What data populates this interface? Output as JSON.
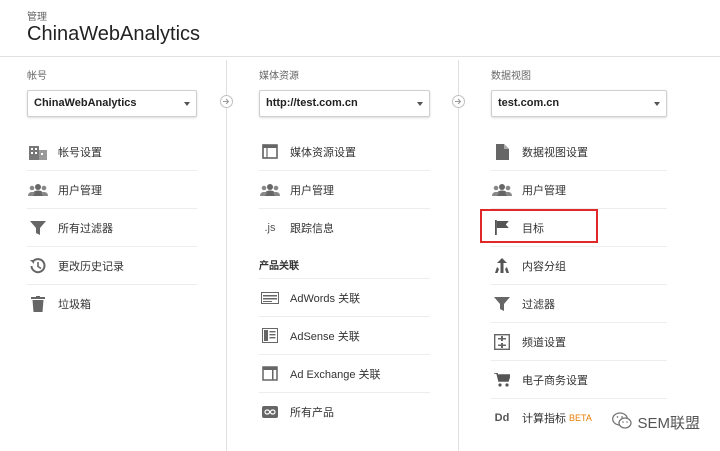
{
  "header": {
    "breadcrumb": "管理",
    "title": "ChinaWebAnalytics"
  },
  "account": {
    "label": "帐号",
    "selected": "ChinaWebAnalytics",
    "items": [
      {
        "label": "帐号设置",
        "icon": "account-settings-icon"
      },
      {
        "label": "用户管理",
        "icon": "users-icon"
      },
      {
        "label": "所有过滤器",
        "icon": "filter-icon"
      },
      {
        "label": "更改历史记录",
        "icon": "history-icon"
      },
      {
        "label": "垃圾箱",
        "icon": "trash-icon"
      }
    ]
  },
  "property": {
    "label": "媒体资源",
    "selected": "http://test.com.cn",
    "items": [
      {
        "label": "媒体资源设置",
        "icon": "property-settings-icon"
      },
      {
        "label": "用户管理",
        "icon": "users-icon"
      },
      {
        "label": "跟踪信息",
        "icon": "js-icon",
        "glyph": ".js"
      }
    ],
    "linking_title": "产品关联",
    "linking_items": [
      {
        "label": "AdWords 关联",
        "icon": "adwords-icon"
      },
      {
        "label": "AdSense 关联",
        "icon": "adsense-icon"
      },
      {
        "label": "Ad Exchange 关联",
        "icon": "ad-exchange-icon"
      },
      {
        "label": "所有产品",
        "icon": "link-icon"
      }
    ]
  },
  "view": {
    "label": "数据视图",
    "selected": "test.com.cn",
    "items": [
      {
        "label": "数据视图设置",
        "icon": "document-icon"
      },
      {
        "label": "用户管理",
        "icon": "users-icon"
      },
      {
        "label": "目标",
        "icon": "flag-icon"
      },
      {
        "label": "内容分组",
        "icon": "content-grouping-icon"
      },
      {
        "label": "过滤器",
        "icon": "filter-icon"
      },
      {
        "label": "频道设置",
        "icon": "channel-settings-icon"
      },
      {
        "label": "电子商务设置",
        "icon": "cart-icon"
      },
      {
        "label": "计算指标",
        "icon": "calculated-metrics-icon",
        "glyph": "Dd",
        "badge": "BETA"
      }
    ]
  },
  "watermark": "SEM联盟",
  "colors": {
    "highlight": "#e02828",
    "beta": "#e67c00",
    "icon": "#666666"
  }
}
